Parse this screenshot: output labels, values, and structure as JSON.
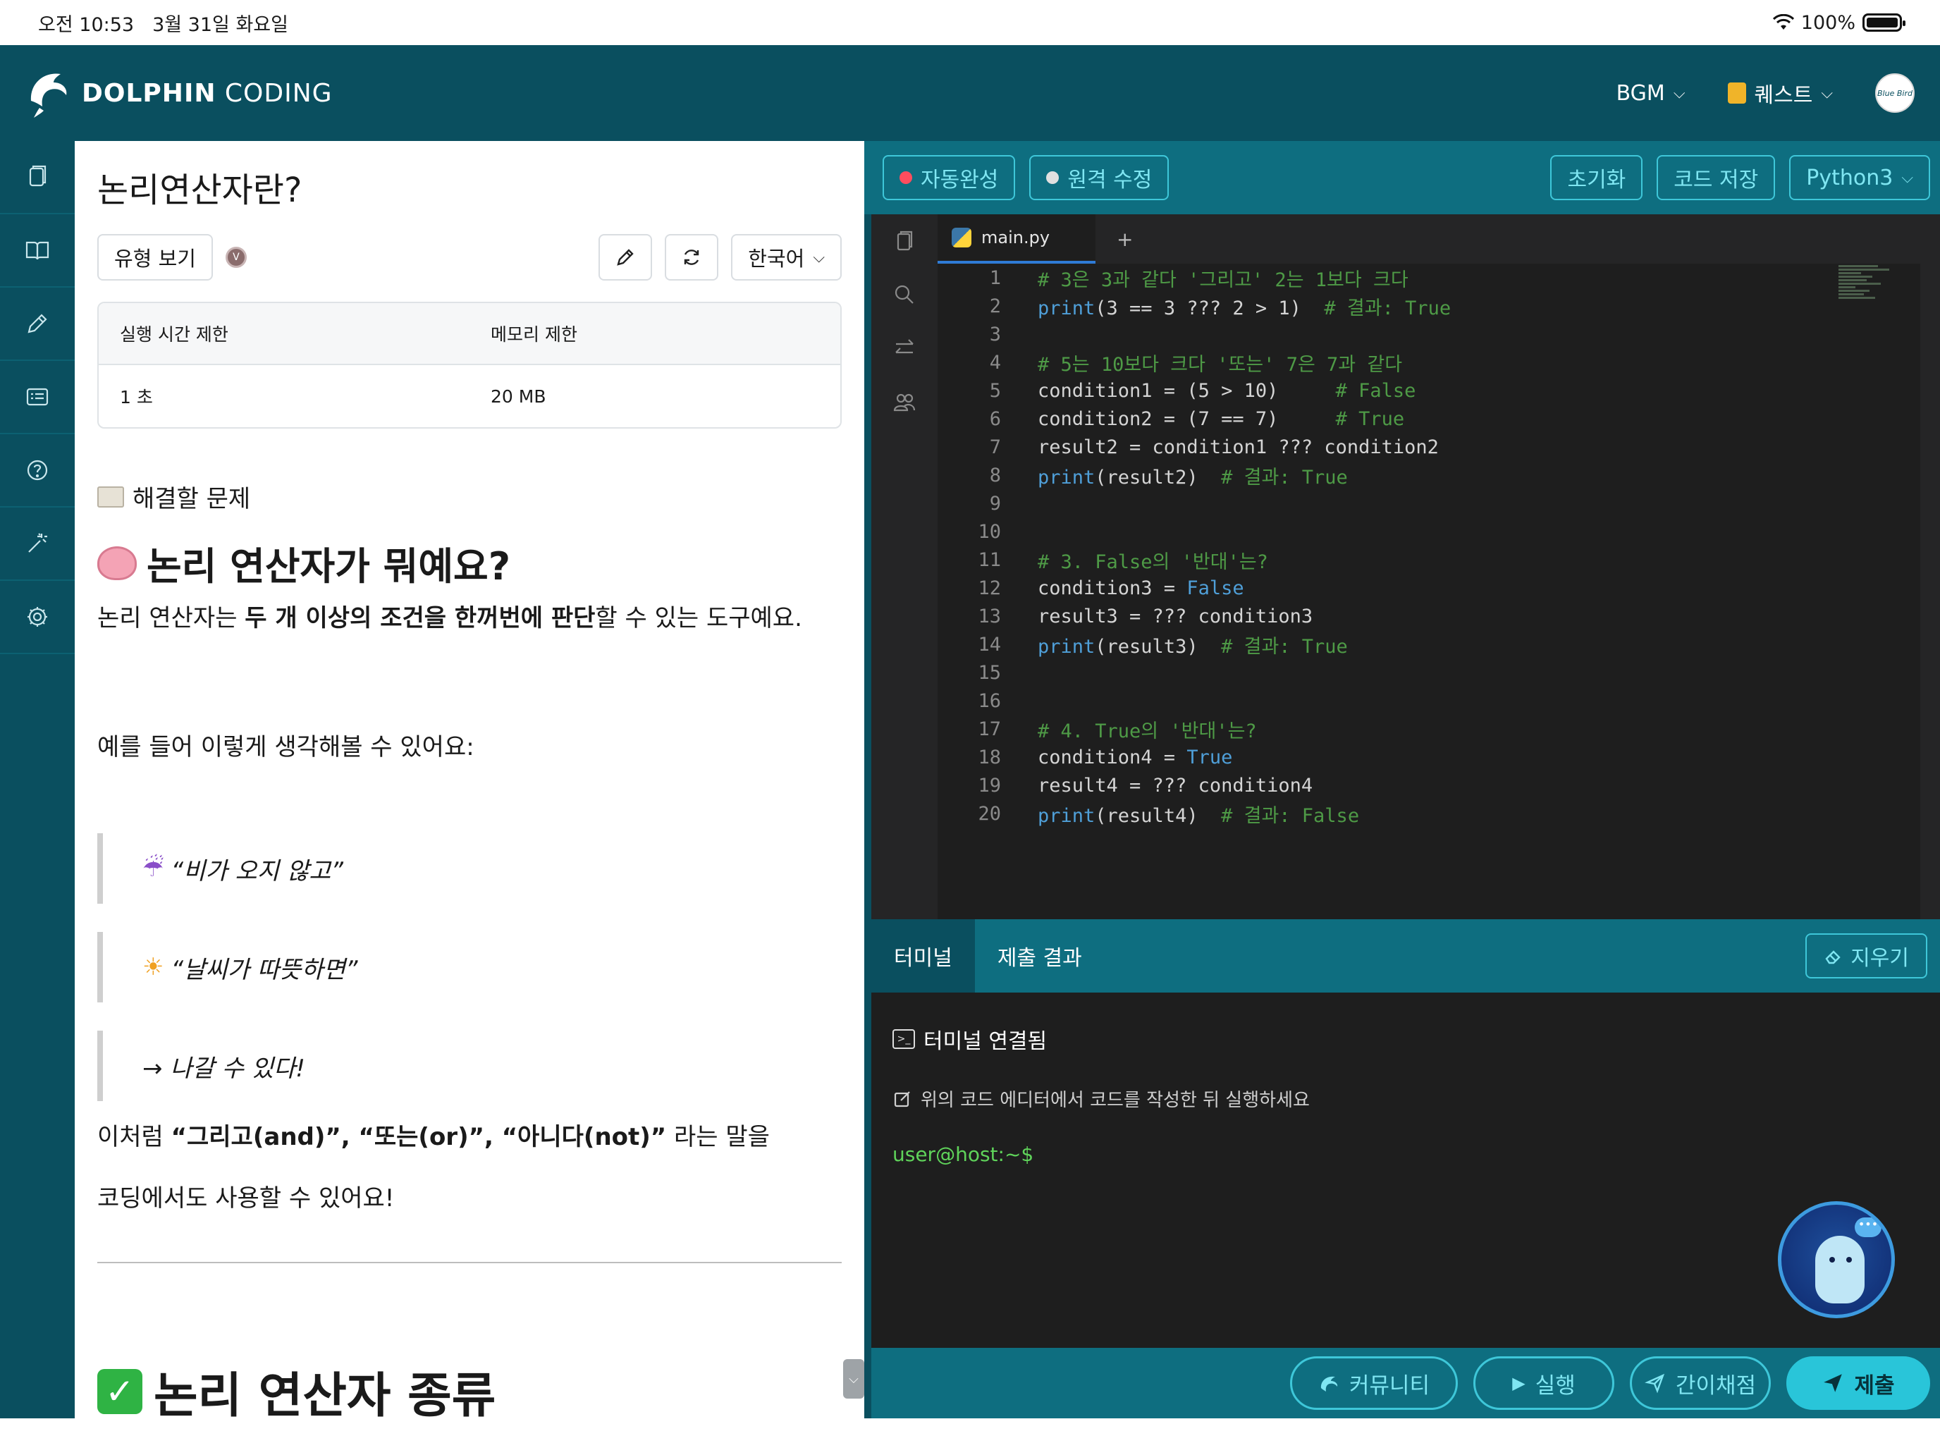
{
  "status_bar": {
    "time": "오전 10:53",
    "date": "3월 31일 화요일",
    "battery": "100%"
  },
  "nav": {
    "brand_bold": "DOLPHIN",
    "brand_light": "CODING",
    "bgm": "BGM",
    "quest": "퀘스트",
    "avatar_text": "Blue Bird"
  },
  "rail": {
    "icons": [
      "copy-icon",
      "book-icon",
      "pencil-icon",
      "list-icon",
      "help-icon",
      "wand-icon",
      "gear-icon"
    ]
  },
  "problem": {
    "title": "논리연산자란?",
    "type_button": "유형 보기",
    "badge": "V",
    "language": "한국어",
    "limits": {
      "time_header": "실행 시간 제한",
      "memory_header": "메모리 제한",
      "time_value": "1 초",
      "memory_value": "20 MB"
    },
    "section_title": "해결할 문제",
    "heading": "논리 연산자가 뭐예요?",
    "intro_pre": "논리 연산자는 ",
    "intro_bold": "두 개 이상의 조건을 한꺼번에 판단",
    "intro_post": "할 수 있는 도구예요.",
    "example_intro": "예를 들어 이렇게 생각해볼 수 있어요:",
    "quote1_icon": "☔",
    "quote1": "“비가 오지 않고”",
    "quote2_icon": "☀",
    "quote2": "“날씨가 따뜻하면”",
    "quote3": "→ 나갈 수 있다!",
    "summary_pre": "이처럼 ",
    "summary_bold": "“그리고(and)”, “또는(or)”, “아니다(not)”",
    "summary_post": " 라는 말을",
    "summary2": "코딩에서도 사용할 수 있어요!",
    "heading2": "논리 연산자 종류"
  },
  "editor": {
    "autocomplete": "자동완성",
    "remote_edit": "원격 수정",
    "reset": "초기화",
    "save": "코드 저장",
    "language": "Python3",
    "tab_name": "main.py",
    "tab_add": "+",
    "code_lines": [
      {
        "n": "1",
        "segments": [
          {
            "t": "# 3은 3과 같다 '그리고' 2는 1보다 크다",
            "c": "comment"
          }
        ]
      },
      {
        "n": "2",
        "segments": [
          {
            "t": "print",
            "c": "kw"
          },
          {
            "t": "(3 == 3 ??? 2 > 1)  ",
            "c": "plain"
          },
          {
            "t": "# 결과: True",
            "c": "comment"
          }
        ]
      },
      {
        "n": "3",
        "segments": []
      },
      {
        "n": "4",
        "segments": [
          {
            "t": "# 5는 10보다 크다 '또는' 7은 7과 같다",
            "c": "comment"
          }
        ]
      },
      {
        "n": "5",
        "segments": [
          {
            "t": "condition1 = (5 > 10)     ",
            "c": "plain"
          },
          {
            "t": "# False",
            "c": "comment"
          }
        ]
      },
      {
        "n": "6",
        "segments": [
          {
            "t": "condition2 = (7 == 7)     ",
            "c": "plain"
          },
          {
            "t": "# True",
            "c": "comment"
          }
        ]
      },
      {
        "n": "7",
        "segments": [
          {
            "t": "result2 = condition1 ??? condition2",
            "c": "plain"
          }
        ]
      },
      {
        "n": "8",
        "segments": [
          {
            "t": "print",
            "c": "kw"
          },
          {
            "t": "(result2)  ",
            "c": "plain"
          },
          {
            "t": "# 결과: True",
            "c": "comment"
          }
        ]
      },
      {
        "n": "9",
        "segments": []
      },
      {
        "n": "10",
        "segments": []
      },
      {
        "n": "11",
        "segments": [
          {
            "t": "# 3. False의 '반대'는?",
            "c": "comment"
          }
        ]
      },
      {
        "n": "12",
        "segments": [
          {
            "t": "condition3 = ",
            "c": "plain"
          },
          {
            "t": "False",
            "c": "kw"
          }
        ]
      },
      {
        "n": "13",
        "segments": [
          {
            "t": "result3 = ??? condition3",
            "c": "plain"
          }
        ]
      },
      {
        "n": "14",
        "segments": [
          {
            "t": "print",
            "c": "kw"
          },
          {
            "t": "(result3)  ",
            "c": "plain"
          },
          {
            "t": "# 결과: True",
            "c": "comment"
          }
        ]
      },
      {
        "n": "15",
        "segments": []
      },
      {
        "n": "16",
        "segments": []
      },
      {
        "n": "17",
        "segments": [
          {
            "t": "# 4. True의 '반대'는?",
            "c": "comment"
          }
        ]
      },
      {
        "n": "18",
        "segments": [
          {
            "t": "condition4 = ",
            "c": "plain"
          },
          {
            "t": "True",
            "c": "kw"
          }
        ]
      },
      {
        "n": "19",
        "segments": [
          {
            "t": "result4 = ??? condition4",
            "c": "plain"
          }
        ]
      },
      {
        "n": "20",
        "segments": [
          {
            "t": "print",
            "c": "kw"
          },
          {
            "t": "(result4)  ",
            "c": "plain"
          },
          {
            "t": "# 결과: False",
            "c": "comment"
          }
        ]
      }
    ]
  },
  "terminal": {
    "tab_terminal": "터미널",
    "tab_results": "제출 결과",
    "clear": "지우기",
    "connected": "터미널 연결됨",
    "hint": "위의 코드 에디터에서 코드를 작성한 뒤 실행하세요",
    "prompt": "user@host:~$"
  },
  "actions": {
    "community": "커뮤니티",
    "run": "실행",
    "quick_grade": "간이채점",
    "submit": "제출"
  },
  "colors": {
    "comment": "#4e9a46",
    "keyword": "#4f9fd8",
    "plain": "#d4d4d4",
    "brand": "#0a4f5f",
    "accent": "#3ec7d9"
  }
}
